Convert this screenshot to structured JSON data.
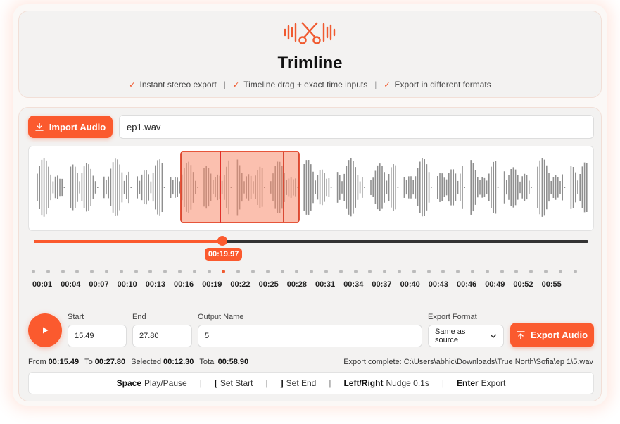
{
  "app": {
    "title": "Trimline",
    "features": [
      "Instant stereo export",
      "Timeline drag + exact time inputs",
      "Export in different formats"
    ],
    "accent": "#fb5a2e"
  },
  "import": {
    "label": "Import Audio",
    "file_name": "ep1.wav"
  },
  "timeline": {
    "current_time": "00:19.97",
    "position_fraction": 0.34,
    "selection_start_fraction": 0.267,
    "selection_end_fraction": 0.479,
    "ticks": [
      "00:01",
      "00:04",
      "00:07",
      "00:10",
      "00:13",
      "00:16",
      "00:19",
      "00:22",
      "00:25",
      "00:28",
      "00:31",
      "00:34",
      "00:37",
      "00:40",
      "00:43",
      "00:46",
      "00:49",
      "00:52",
      "00:55"
    ]
  },
  "form": {
    "start_label": "Start",
    "start_value": "15.49",
    "end_label": "End",
    "end_value": "27.80",
    "name_label": "Output Name",
    "name_value": "5",
    "format_label": "Export Format",
    "format_value": "Same as source",
    "export_label": "Export Audio"
  },
  "stats": {
    "from_label": "From",
    "from_value": "00:15.49",
    "to_label": "To",
    "to_value": "00:27.80",
    "selected_label": "Selected",
    "selected_value": "00:12.30",
    "total_label": "Total",
    "total_value": "00:58.90",
    "export_status": "Export complete: C:\\Users\\abhic\\Downloads\\True North\\Sofia\\ep 1\\5.wav"
  },
  "shortcuts": [
    {
      "key": "Space",
      "action": "Play/Pause"
    },
    {
      "key": "[",
      "action": "Set Start"
    },
    {
      "key": "]",
      "action": "Set End"
    },
    {
      "key": "Left/Right",
      "action": "Nudge 0.1s"
    },
    {
      "key": "Enter",
      "action": "Export"
    }
  ]
}
